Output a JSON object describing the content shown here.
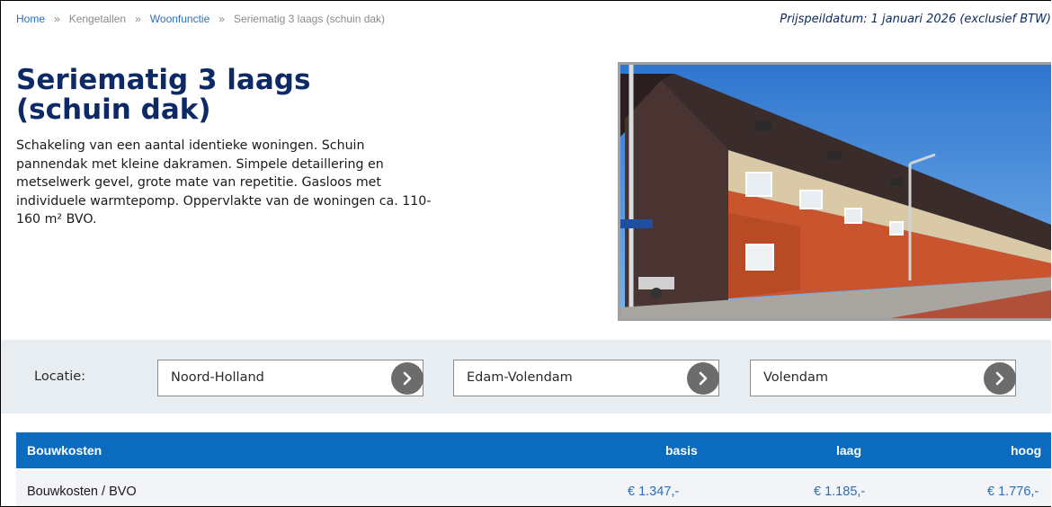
{
  "breadcrumb": {
    "home": "Home",
    "sep": "»",
    "kengetallen": "Kengetallen",
    "woonfunctie": "Woonfunctie",
    "current": "Seriematig 3 laags (schuin dak)"
  },
  "price_date": "Prijspeildatum: 1 januari 2026 (exclusief BTW)",
  "title_line1": "Seriematig 3 laags",
  "title_line2": "(schuin dak)",
  "description": "Schakeling van een aantal identieke woningen. Schuin pannendak met kleine dakramen. Simpele detaillering en metselwerk gevel, grote mate van repetitie. Gasloos met individuele warmtepomp. Oppervlakte van de woningen ca. 110-160 m² BVO.",
  "location": {
    "label": "Locatie:",
    "province": "Noord-Holland",
    "municipality": "Edam-Volendam",
    "place": "Volendam"
  },
  "table": {
    "header": {
      "name": "Bouwkosten",
      "basis": "basis",
      "laag": "laag",
      "hoog": "hoog"
    },
    "row": {
      "name": "Bouwkosten / BVO",
      "basis": "€ 1.347,-",
      "laag": "€ 1.185,-",
      "hoog": "€ 1.776,-"
    }
  },
  "colors": {
    "header_blue": "#0a6bbf",
    "title_navy": "#0d2a66",
    "link_blue": "#2a6ebb",
    "bar_grey": "#e8edf2"
  },
  "icons": {
    "go": "chevron-right-icon"
  }
}
